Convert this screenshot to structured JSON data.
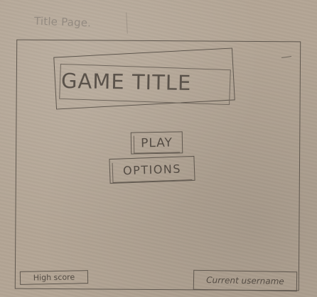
{
  "page": {
    "label": "Title Page."
  },
  "title_screen": {
    "game_title": "GAME TITLE",
    "play_label": "PLAY",
    "options_label": "OPTIONS",
    "high_score_label": "High score",
    "username_label": "Current username"
  },
  "colors": {
    "paper": "#b3a595",
    "pencil": "#5f574e",
    "faint_pencil": "#938a80"
  }
}
